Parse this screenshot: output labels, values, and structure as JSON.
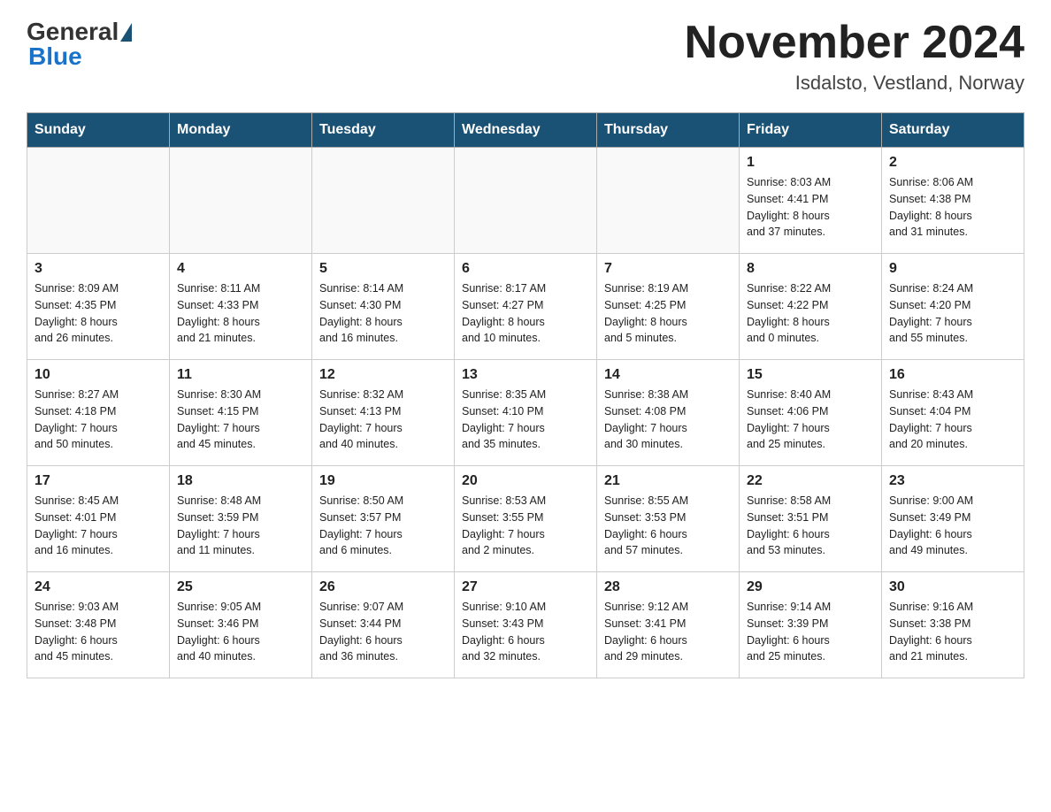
{
  "header": {
    "title": "November 2024",
    "subtitle": "Isdalsto, Vestland, Norway"
  },
  "logo": {
    "general": "General",
    "blue": "Blue"
  },
  "weekdays": [
    "Sunday",
    "Monday",
    "Tuesday",
    "Wednesday",
    "Thursday",
    "Friday",
    "Saturday"
  ],
  "weeks": [
    [
      {
        "day": "",
        "info": ""
      },
      {
        "day": "",
        "info": ""
      },
      {
        "day": "",
        "info": ""
      },
      {
        "day": "",
        "info": ""
      },
      {
        "day": "",
        "info": ""
      },
      {
        "day": "1",
        "info": "Sunrise: 8:03 AM\nSunset: 4:41 PM\nDaylight: 8 hours\nand 37 minutes."
      },
      {
        "day": "2",
        "info": "Sunrise: 8:06 AM\nSunset: 4:38 PM\nDaylight: 8 hours\nand 31 minutes."
      }
    ],
    [
      {
        "day": "3",
        "info": "Sunrise: 8:09 AM\nSunset: 4:35 PM\nDaylight: 8 hours\nand 26 minutes."
      },
      {
        "day": "4",
        "info": "Sunrise: 8:11 AM\nSunset: 4:33 PM\nDaylight: 8 hours\nand 21 minutes."
      },
      {
        "day": "5",
        "info": "Sunrise: 8:14 AM\nSunset: 4:30 PM\nDaylight: 8 hours\nand 16 minutes."
      },
      {
        "day": "6",
        "info": "Sunrise: 8:17 AM\nSunset: 4:27 PM\nDaylight: 8 hours\nand 10 minutes."
      },
      {
        "day": "7",
        "info": "Sunrise: 8:19 AM\nSunset: 4:25 PM\nDaylight: 8 hours\nand 5 minutes."
      },
      {
        "day": "8",
        "info": "Sunrise: 8:22 AM\nSunset: 4:22 PM\nDaylight: 8 hours\nand 0 minutes."
      },
      {
        "day": "9",
        "info": "Sunrise: 8:24 AM\nSunset: 4:20 PM\nDaylight: 7 hours\nand 55 minutes."
      }
    ],
    [
      {
        "day": "10",
        "info": "Sunrise: 8:27 AM\nSunset: 4:18 PM\nDaylight: 7 hours\nand 50 minutes."
      },
      {
        "day": "11",
        "info": "Sunrise: 8:30 AM\nSunset: 4:15 PM\nDaylight: 7 hours\nand 45 minutes."
      },
      {
        "day": "12",
        "info": "Sunrise: 8:32 AM\nSunset: 4:13 PM\nDaylight: 7 hours\nand 40 minutes."
      },
      {
        "day": "13",
        "info": "Sunrise: 8:35 AM\nSunset: 4:10 PM\nDaylight: 7 hours\nand 35 minutes."
      },
      {
        "day": "14",
        "info": "Sunrise: 8:38 AM\nSunset: 4:08 PM\nDaylight: 7 hours\nand 30 minutes."
      },
      {
        "day": "15",
        "info": "Sunrise: 8:40 AM\nSunset: 4:06 PM\nDaylight: 7 hours\nand 25 minutes."
      },
      {
        "day": "16",
        "info": "Sunrise: 8:43 AM\nSunset: 4:04 PM\nDaylight: 7 hours\nand 20 minutes."
      }
    ],
    [
      {
        "day": "17",
        "info": "Sunrise: 8:45 AM\nSunset: 4:01 PM\nDaylight: 7 hours\nand 16 minutes."
      },
      {
        "day": "18",
        "info": "Sunrise: 8:48 AM\nSunset: 3:59 PM\nDaylight: 7 hours\nand 11 minutes."
      },
      {
        "day": "19",
        "info": "Sunrise: 8:50 AM\nSunset: 3:57 PM\nDaylight: 7 hours\nand 6 minutes."
      },
      {
        "day": "20",
        "info": "Sunrise: 8:53 AM\nSunset: 3:55 PM\nDaylight: 7 hours\nand 2 minutes."
      },
      {
        "day": "21",
        "info": "Sunrise: 8:55 AM\nSunset: 3:53 PM\nDaylight: 6 hours\nand 57 minutes."
      },
      {
        "day": "22",
        "info": "Sunrise: 8:58 AM\nSunset: 3:51 PM\nDaylight: 6 hours\nand 53 minutes."
      },
      {
        "day": "23",
        "info": "Sunrise: 9:00 AM\nSunset: 3:49 PM\nDaylight: 6 hours\nand 49 minutes."
      }
    ],
    [
      {
        "day": "24",
        "info": "Sunrise: 9:03 AM\nSunset: 3:48 PM\nDaylight: 6 hours\nand 45 minutes."
      },
      {
        "day": "25",
        "info": "Sunrise: 9:05 AM\nSunset: 3:46 PM\nDaylight: 6 hours\nand 40 minutes."
      },
      {
        "day": "26",
        "info": "Sunrise: 9:07 AM\nSunset: 3:44 PM\nDaylight: 6 hours\nand 36 minutes."
      },
      {
        "day": "27",
        "info": "Sunrise: 9:10 AM\nSunset: 3:43 PM\nDaylight: 6 hours\nand 32 minutes."
      },
      {
        "day": "28",
        "info": "Sunrise: 9:12 AM\nSunset: 3:41 PM\nDaylight: 6 hours\nand 29 minutes."
      },
      {
        "day": "29",
        "info": "Sunrise: 9:14 AM\nSunset: 3:39 PM\nDaylight: 6 hours\nand 25 minutes."
      },
      {
        "day": "30",
        "info": "Sunrise: 9:16 AM\nSunset: 3:38 PM\nDaylight: 6 hours\nand 21 minutes."
      }
    ]
  ]
}
